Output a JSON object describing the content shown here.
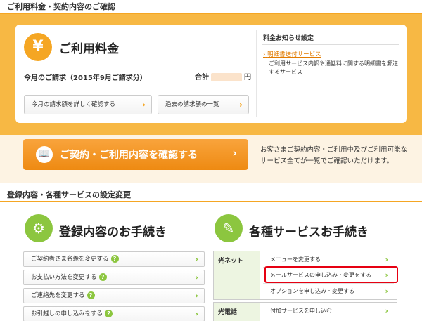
{
  "section1": {
    "title": "ご利用料金・契約内容のご確認"
  },
  "usage": {
    "yen_symbol": "¥",
    "title": "ご利用料金",
    "bill_label": "今月のご請求（2015年9月ご請求分）",
    "total_label": "合計",
    "total_unit": "円",
    "detail_button": "今月の請求額を詳しく確認する",
    "history_button": "過去の請求額の一覧"
  },
  "notice": {
    "heading": "料金お知らせ設定",
    "link": "明細書送付サービス",
    "desc": "ご利用サービス内訳や通話料に関する明細書を郵送するサービス"
  },
  "contract": {
    "button_label": "ご契約・ご利用内容を確認する",
    "desc": "お客さまご契約内容・ご利用中及びご利用可能なサービス全てが一覧でご確認いただけます。"
  },
  "section2": {
    "title": "登録内容・各種サービスの設定変更"
  },
  "registration": {
    "title": "登録内容のお手続き",
    "items": [
      {
        "label": "ご契約者さま名義を変更する"
      },
      {
        "label": "お支払い方法を変更する"
      },
      {
        "label": "ご連絡先を変更する"
      },
      {
        "label": "お引越しの申し込みをする"
      }
    ]
  },
  "services": {
    "title": "各種サービスお手続き",
    "hikari_net": {
      "category": "光ネット",
      "items": [
        {
          "label": "メニューを変更する"
        },
        {
          "label": "メールサービスの申し込み・変更をする"
        },
        {
          "label": "オプションを申し込み・変更する"
        }
      ]
    },
    "hikari_phone": {
      "category": "光電話",
      "items": [
        {
          "label": "付加サービスを申し込む"
        }
      ]
    }
  },
  "icons": {
    "arrow": "›",
    "help": "?",
    "book": "📖",
    "gear": "⚙",
    "form": "✎"
  },
  "colors": {
    "orange": "#f5a623",
    "green": "#8cc63f",
    "highlight": "#e60012"
  }
}
